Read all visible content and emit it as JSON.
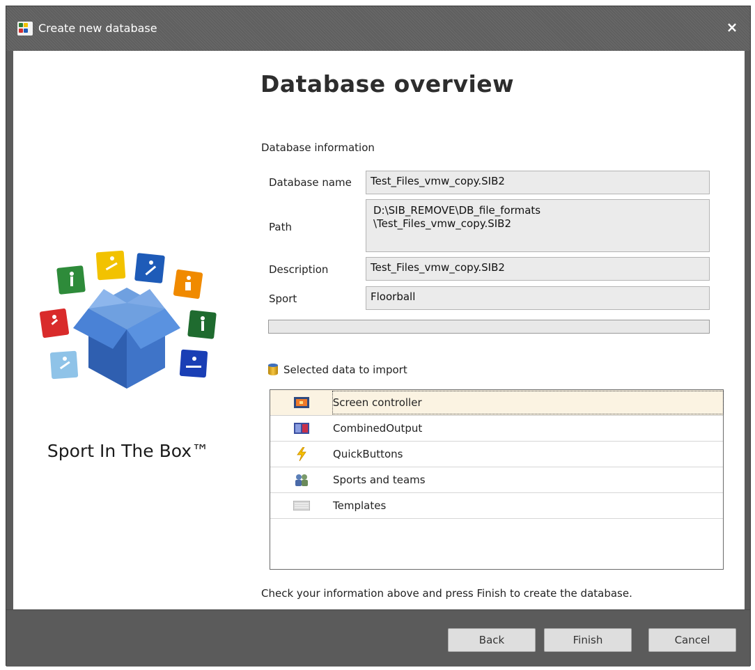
{
  "window": {
    "title": "Create new database",
    "close_glyph": "×"
  },
  "heading": "Database overview",
  "db_info_label": "Database information",
  "fields": {
    "name": {
      "label": "Database name",
      "value": "Test_Files_vmw_copy.SIB2"
    },
    "path": {
      "label": "Path",
      "value_line1": "D:\\SIB_REMOVE\\DB_file_formats",
      "value_line2": "\\Test_Files_vmw_copy.SIB2"
    },
    "description": {
      "label": "Description",
      "value": "Test_Files_vmw_copy.SIB2"
    },
    "sport": {
      "label": "Sport",
      "value": "Floorball"
    }
  },
  "progress": {
    "fraction": 0
  },
  "import": {
    "label": "Selected data to import",
    "items": [
      {
        "label": "Screen controller",
        "icon": "screen-controller-icon",
        "selected": true
      },
      {
        "label": "CombinedOutput",
        "icon": "combined-output-icon",
        "selected": false
      },
      {
        "label": "QuickButtons",
        "icon": "lightning-icon",
        "selected": false
      },
      {
        "label": "Sports and teams",
        "icon": "teams-icon",
        "selected": false
      },
      {
        "label": "Templates",
        "icon": "template-icon",
        "selected": false
      }
    ]
  },
  "footer_text": "Check your information above and press Finish to create the database.",
  "logo_caption": "Sport In The Box™",
  "buttons": {
    "back": "Back",
    "finish": "Finish",
    "cancel": "Cancel"
  },
  "colors": {
    "chrome": "#5b5b5b",
    "selection": "#fbf3e2",
    "field_bg": "#ebebeb"
  }
}
